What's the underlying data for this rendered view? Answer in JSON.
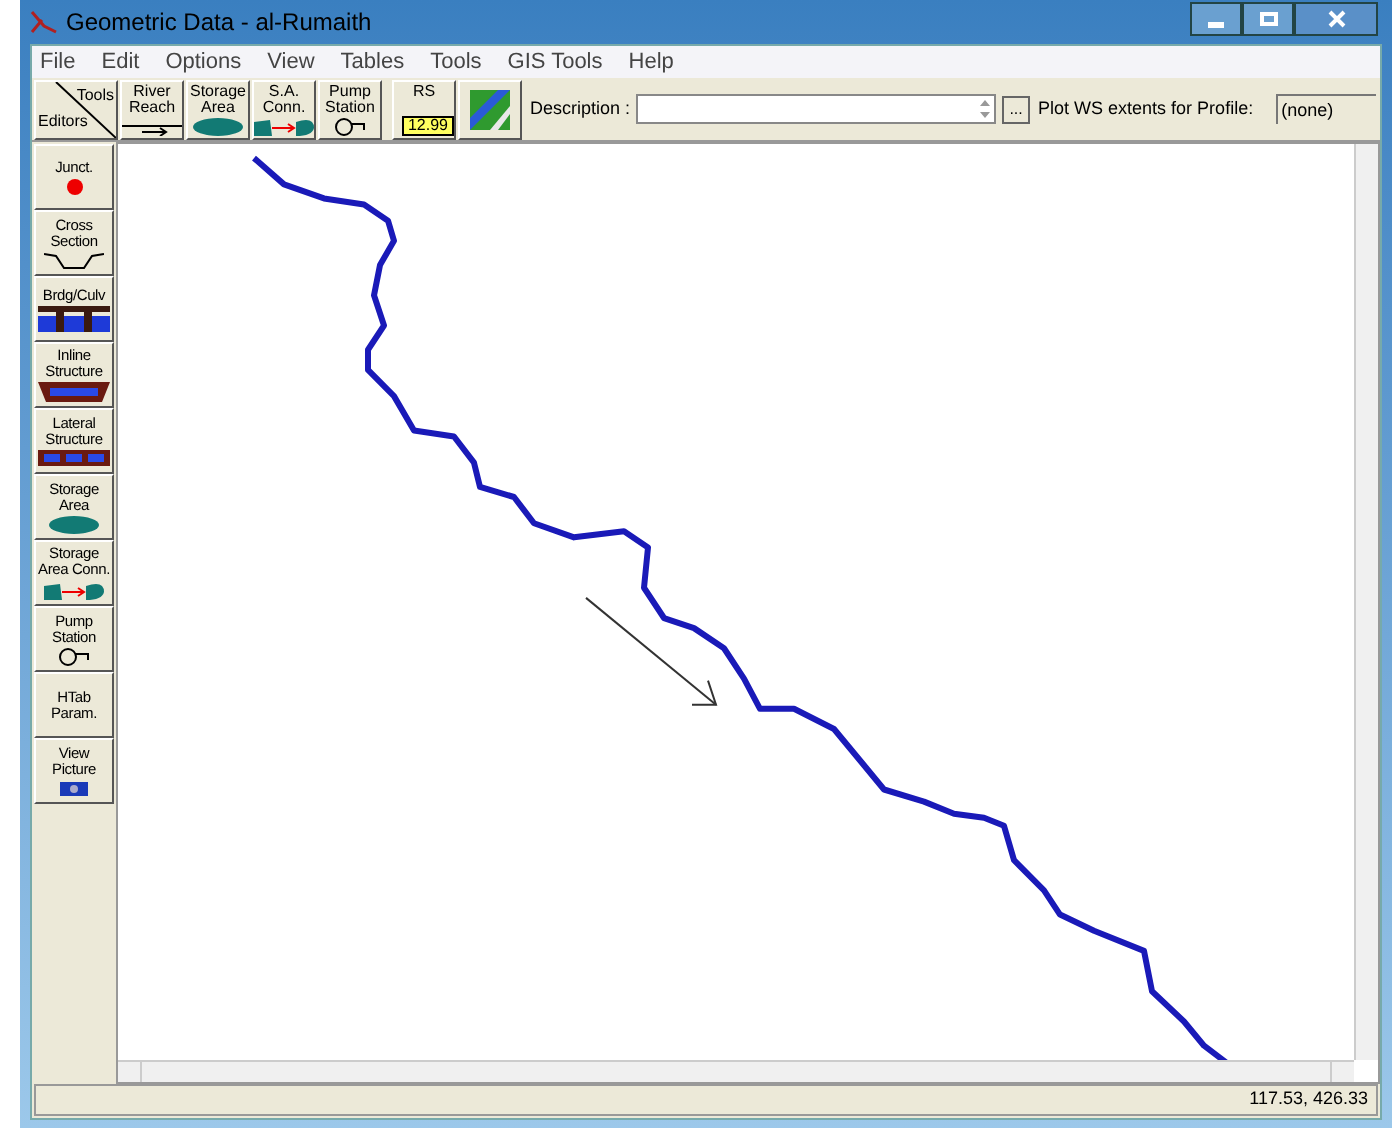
{
  "window": {
    "title": "Geometric Data - al-Rumaith"
  },
  "menu": [
    "File",
    "Edit",
    "Options",
    "View",
    "Tables",
    "Tools",
    "GIS Tools",
    "Help"
  ],
  "toolbar": {
    "corner": {
      "top": "Tools",
      "bottom": "Editors"
    },
    "tools": [
      {
        "kind": "reach",
        "lines": [
          "River",
          "Reach"
        ]
      },
      {
        "kind": "storage",
        "lines": [
          "Storage",
          "Area"
        ]
      },
      {
        "kind": "conn",
        "lines": [
          "S.A.",
          "Conn."
        ]
      },
      {
        "kind": "pump",
        "lines": [
          "Pump",
          "Station"
        ]
      },
      {
        "kind": "rs",
        "lines": [
          "RS"
        ],
        "tag": "12.99"
      },
      {
        "kind": "map"
      }
    ],
    "description_label": "Description :",
    "browse": "...",
    "profile_label": "Plot WS extents for Profile:",
    "profile_value": "(none)"
  },
  "editors": [
    {
      "kind": "junction",
      "lines": [
        "Junct."
      ]
    },
    {
      "kind": "cross",
      "lines": [
        "Cross",
        "Section"
      ]
    },
    {
      "kind": "bridge",
      "lines": [
        "Brdg/Culv"
      ]
    },
    {
      "kind": "inline",
      "lines": [
        "Inline",
        "Structure"
      ]
    },
    {
      "kind": "lateral",
      "lines": [
        "Lateral",
        "Structure"
      ]
    },
    {
      "kind": "storage",
      "lines": [
        "Storage",
        "Area"
      ]
    },
    {
      "kind": "conn",
      "lines": [
        "Storage",
        "Area Conn."
      ]
    },
    {
      "kind": "pump",
      "lines": [
        "Pump",
        "Station"
      ]
    },
    {
      "kind": "none",
      "lines": [
        "HTab",
        "Param."
      ]
    },
    {
      "kind": "camera",
      "lines": [
        "View",
        "Picture"
      ]
    }
  ],
  "status_bar": {
    "coordinates": "117.53, 426.33"
  }
}
